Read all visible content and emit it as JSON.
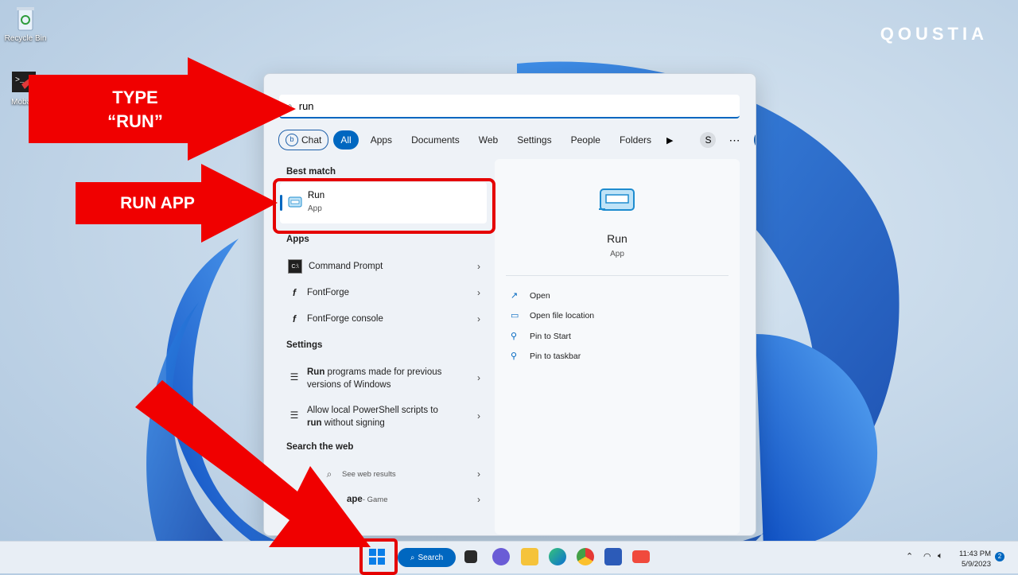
{
  "brand": "QOUSTIA",
  "desktop": {
    "icons": [
      {
        "label": "Recycle Bin",
        "icon": "recycle-bin-icon"
      },
      {
        "label": "MobaX",
        "icon": "terminal-icon"
      }
    ]
  },
  "annotations": {
    "type_run": "TYPE\n“RUN”",
    "run_app": "RUN APP",
    "accent_color": "#e50000"
  },
  "search": {
    "value": "run",
    "filters": [
      "Chat",
      "All",
      "Apps",
      "Documents",
      "Web",
      "Settings",
      "People",
      "Folders"
    ],
    "active_filter": "All",
    "avatar_letter": "S"
  },
  "results": {
    "best_match_heading": "Best match",
    "best_match": {
      "title": "Run",
      "subtitle": "App"
    },
    "apps_heading": "Apps",
    "apps": [
      {
        "label": "Command Prompt",
        "icon": "cmd-icon"
      },
      {
        "label": "FontForge",
        "icon": "fontforge-icon"
      },
      {
        "label": "FontForge console",
        "icon": "fontforge-icon"
      }
    ],
    "settings_heading": "Settings",
    "settings": [
      {
        "bold": "Run",
        "line1": " programs made for previous",
        "line2": "versions of Windows"
      },
      {
        "line1": "Allow local PowerShell scripts to",
        "bold": "run",
        "line2": " without signing"
      }
    ],
    "web_heading": "Search the web",
    "web": [
      {
        "label": "See web results"
      },
      {
        "label": "ape",
        "suffix": " - Game"
      }
    ]
  },
  "preview": {
    "title": "Run",
    "subtitle": "App",
    "actions": [
      "Open",
      "Open file location",
      "Pin to Start",
      "Pin to taskbar"
    ]
  },
  "taskbar": {
    "search_label": "Search",
    "time": "11:43 PM",
    "date": "5/9/2023",
    "notifications": "2"
  }
}
